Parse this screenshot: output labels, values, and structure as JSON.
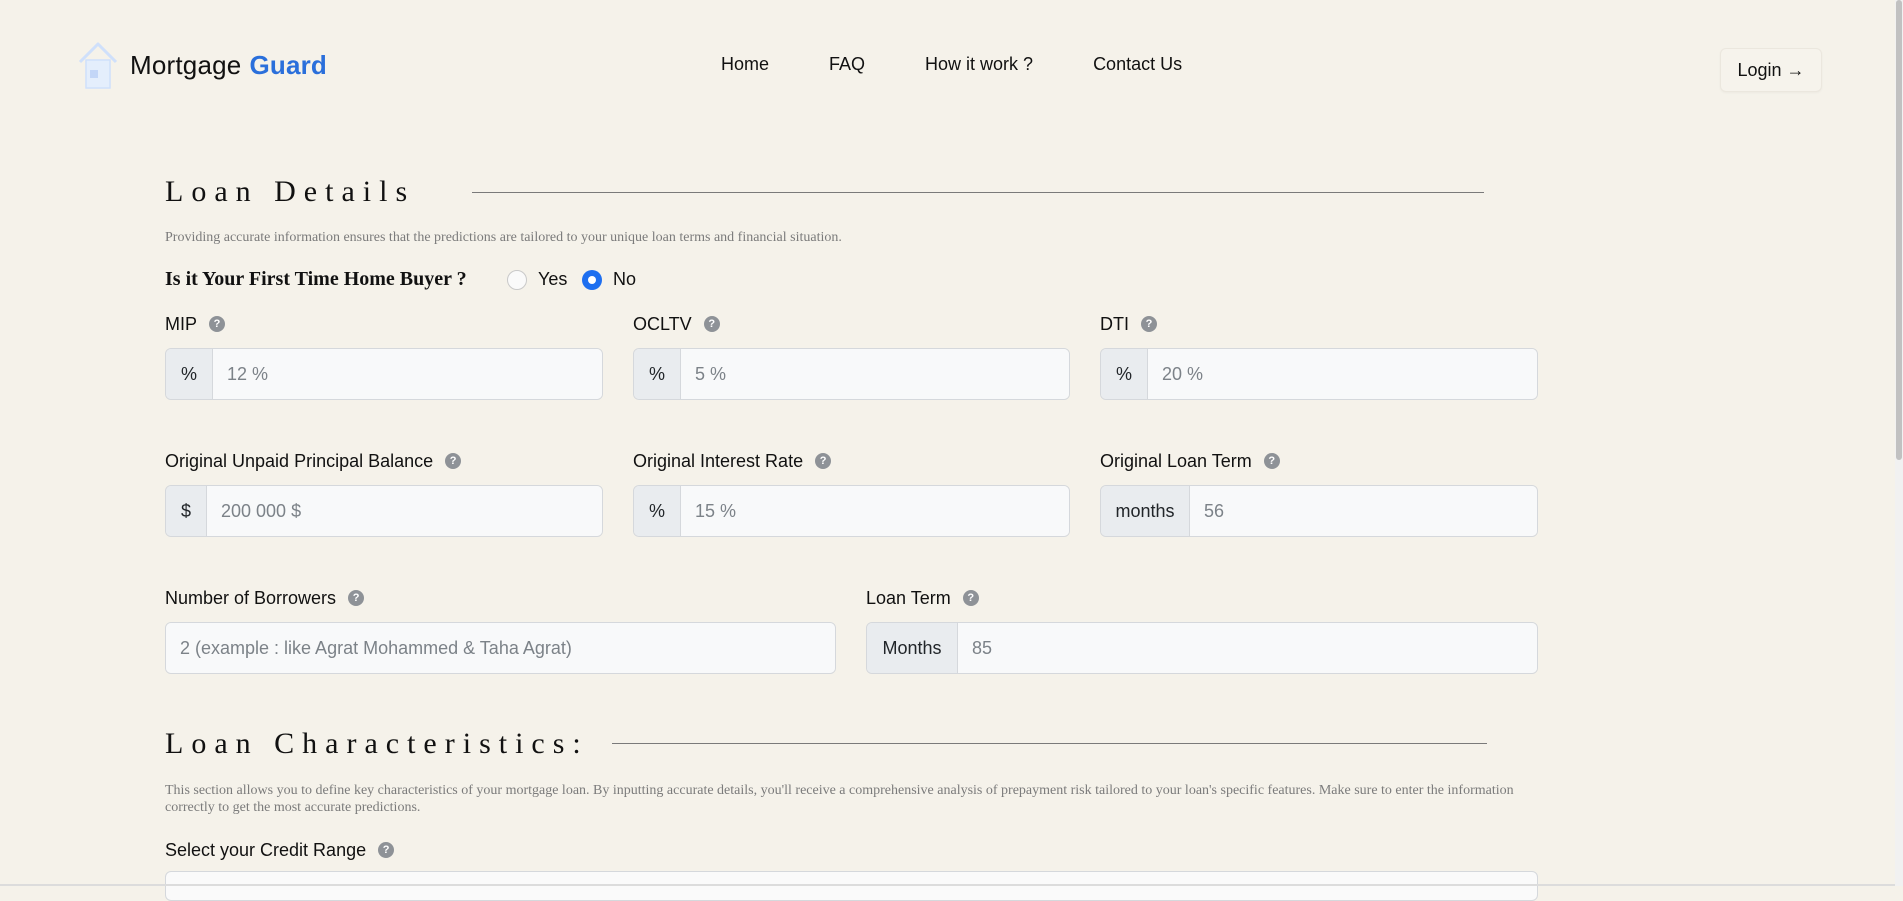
{
  "brand": {
    "name": "Mortgage",
    "accent": "Guard",
    "accent_color": "#2a6fdb",
    "icon": "house-icon"
  },
  "nav": {
    "items": [
      "Home",
      "FAQ",
      "How it work ?",
      "Contact Us"
    ],
    "login": "Login →"
  },
  "loan_details": {
    "title": "Loan Details",
    "description": "Providing accurate information ensures that the predictions are tailored to your unique loan terms and financial situation.",
    "first_time_buyer": {
      "question": "Is it Your First Time Home Buyer ?",
      "options": [
        "Yes",
        "No"
      ],
      "selected": "No"
    },
    "fields": {
      "mip": {
        "label": "MIP",
        "addon": "%",
        "placeholder": "12 %"
      },
      "ocltv": {
        "label": "OCLTV",
        "addon": "%",
        "placeholder": "5 %"
      },
      "dti": {
        "label": "DTI",
        "addon": "%",
        "placeholder": "20 %"
      },
      "upb": {
        "label": "Original Unpaid Principal Balance",
        "addon": "$",
        "placeholder": "200 000 $"
      },
      "interest_rate": {
        "label": "Original Interest Rate",
        "addon": "%",
        "placeholder": "15 %"
      },
      "orig_loan_term": {
        "label": "Original Loan Term",
        "addon": "months",
        "placeholder": "56"
      },
      "borrowers": {
        "label": "Number of Borrowers",
        "placeholder": "2 (example : like Agrat Mohammed & Taha Agrat)"
      },
      "loan_term": {
        "label": "Loan Term",
        "addon": "Months",
        "placeholder": "85"
      }
    }
  },
  "loan_characteristics": {
    "title": "Loan Characteristics:",
    "description": "This section allows you to define key characteristics of your mortgage loan. By inputting accurate details, you'll receive a comprehensive analysis of prepayment risk tailored to your loan's specific features. Make sure to enter the information correctly to get the most accurate predictions.",
    "credit_range": {
      "label": "Select your Credit Range"
    }
  },
  "help_icon": "question-circle-icon"
}
